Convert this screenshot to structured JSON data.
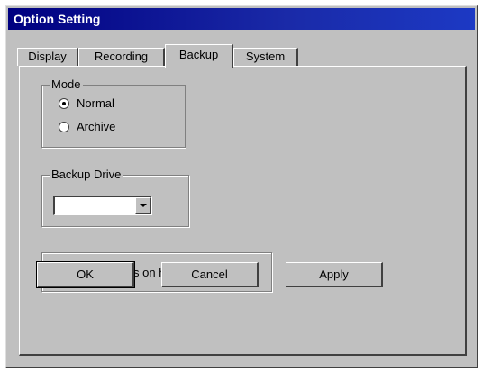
{
  "window": {
    "title": "Option Setting"
  },
  "tabs": [
    {
      "label": "Display",
      "active": false
    },
    {
      "label": "Recording",
      "active": false
    },
    {
      "label": "Backup",
      "active": true
    },
    {
      "label": "System",
      "active": false
    }
  ],
  "mode": {
    "title": "Mode",
    "options": [
      {
        "label": "Normal",
        "selected": true
      },
      {
        "label": "Archive",
        "selected": false
      }
    ]
  },
  "backup_drive": {
    "title": "Backup Drive",
    "value": ""
  },
  "keep_copies": {
    "label": "Keep copies on harddisk",
    "checked": false
  },
  "buttons": {
    "ok": "OK",
    "cancel": "Cancel",
    "apply": "Apply"
  },
  "colors": {
    "title_bar": "#000080",
    "face": "#c0c0c0"
  }
}
